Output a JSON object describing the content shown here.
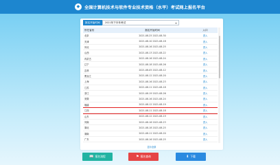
{
  "header": {
    "logo_glyph": "◆",
    "title": "全国计算机技术与软件专业技术资格（水平）考试网上报名平台"
  },
  "filter": {
    "label": "报名开始时间",
    "selected": "2021年下半年考试"
  },
  "table": {
    "columns": [
      "所在省份",
      "报名开始时间",
      "入口"
    ],
    "rows": [
      {
        "province": "北京",
        "time": "2021-08-25 2021-08-30",
        "link": "进入"
      },
      {
        "province": "天津",
        "time": "2021-08-10 2021-08-18",
        "link": "进入"
      },
      {
        "province": "河北",
        "time": "2021-08-16 2021-08-25",
        "link": "进入"
      },
      {
        "province": "山西",
        "time": "2021-08-13 2021-08-22",
        "link": "进入"
      },
      {
        "province": "内蒙古",
        "time": "2021-08-16 2021-08-24",
        "link": "进入"
      },
      {
        "province": "辽宁",
        "time": "2021-08-18 2021-08-26",
        "link": "进入"
      },
      {
        "province": "吉林",
        "time": "2021-08-05 2021-08-12",
        "link": "进入"
      },
      {
        "province": "黑龙江",
        "time": "2021-08-12 2021-08-20",
        "link": "进入"
      },
      {
        "province": "上海",
        "time": "2021-08-16 2021-08-23",
        "link": "进入"
      },
      {
        "province": "江苏",
        "time": "2021-08-11 2021-08-18",
        "link": "进入"
      },
      {
        "province": "浙江",
        "time": "2021-08-19 2021-08-26",
        "link": "进入"
      },
      {
        "province": "安徽",
        "time": "2021-08-16 2021-08-24",
        "link": "进入"
      },
      {
        "province": "福建",
        "time": "2021-08-12 2021-08-19",
        "link": "进入"
      },
      {
        "province": "江西",
        "time": "2021-08-11 2021-08-18",
        "link": "进入"
      },
      {
        "province": "山东",
        "time": "2021-08-12 2021-08-19",
        "link": "进入"
      },
      {
        "province": "河南",
        "time": "2021-08-16 2021-08-23",
        "link": "进入"
      },
      {
        "province": "湖北",
        "time": "2021-08-18 2021-08-25",
        "link": "进入"
      },
      {
        "province": "湖南",
        "time": "2021-08-11 2021-08-20",
        "link": "进入"
      },
      {
        "province": "广东",
        "time": "2021-08-16 2021-08-25",
        "link": "进入"
      },
      {
        "province": "广西",
        "time": "2021-08-12 2021-08-20",
        "link": "进入"
      },
      {
        "province": "海南",
        "time": "2021-08-18 2021-08-26",
        "link": "进入"
      }
    ],
    "highlighted_row": 13
  },
  "footer_link": "显示全部",
  "buttons": [
    {
      "icon": "📖",
      "label": "报名流程"
    },
    {
      "icon": "⚑",
      "label": "报名查询"
    },
    {
      "icon": "⬇",
      "label": "下载"
    }
  ],
  "colors": {
    "header_bg": "#1d86cf",
    "highlight": "#e21f1f",
    "btn_teal": "#21b3a2",
    "btn_red": "#e64545",
    "btn_blue": "#2a8ae0"
  }
}
